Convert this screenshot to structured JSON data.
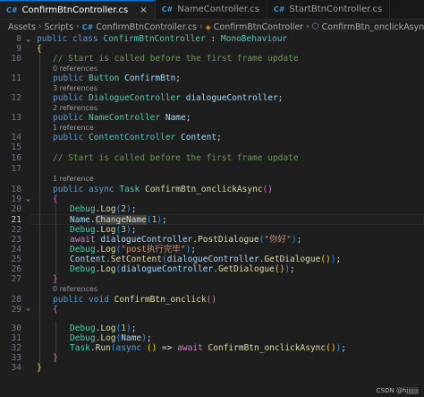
{
  "tabs": [
    {
      "icon": "C#",
      "label": "ConfirmBtnController.cs",
      "active": true,
      "close": "×"
    },
    {
      "icon": "C#",
      "label": "NameController.cs",
      "active": false
    },
    {
      "icon": "C#",
      "label": "StartBtnController.cs",
      "active": false
    }
  ],
  "breadcrumb": {
    "items": [
      "Assets",
      "Scripts"
    ],
    "file": "ConfirmBtnController.cs",
    "class": "ConfirmBtnController",
    "method": "ConfirmBtn_onclickAsync()"
  },
  "editor": {
    "current_line": 21,
    "line_numbers": [
      8,
      9,
      10,
      11,
      12,
      13,
      14,
      15,
      16,
      17,
      18,
      19,
      20,
      21,
      22,
      23,
      24,
      25,
      26,
      27,
      28,
      29,
      30,
      31,
      32,
      33,
      34
    ],
    "codelens": {
      "refs_0": "0 references",
      "refs_3": "3 references",
      "refs_2": "2 references",
      "refs_1a": "1 reference",
      "refs_1b": "1 reference",
      "refs_0b": "0 references"
    },
    "code": {
      "l8": {
        "kw": "public class ",
        "ty": "ConfirmBtnController",
        "sep": " : ",
        "base": "MonoBehaviour"
      },
      "l9": "{",
      "l10": "// Start is called before the first frame update",
      "l11": {
        "kw": "public ",
        "ty": "Button ",
        "va": "ConfirmBtn",
        "end": ";"
      },
      "l12": {
        "kw": "public ",
        "ty": "DialogueController ",
        "va": "dialogueController",
        "end": ";"
      },
      "l13": {
        "kw": "public ",
        "ty": "NameController ",
        "va": "Name",
        "end": ";"
      },
      "l14": {
        "kw": "public ",
        "ty": "ContentController ",
        "va": "Content",
        "end": ";"
      },
      "l16": "// Start is called before the first frame update",
      "l18": {
        "kw": "public async ",
        "ty": "Task ",
        "fn": "ConfirmBtn_onclickAsync",
        "paren": "()"
      },
      "l19": "{",
      "l20": {
        "ty": "Debug",
        "dot": ".",
        "fn": "Log",
        "o": "(",
        "nm": "2",
        "c": ")",
        "end": ";"
      },
      "l21": {
        "va": "Name",
        "dot": ".",
        "fn": "ChangeName",
        "o": "(",
        "nm": "1",
        "c": ")",
        "end": ";"
      },
      "l22": {
        "ty": "Debug",
        "dot": ".",
        "fn": "Log",
        "o": "(",
        "nm": "3",
        "c": ")",
        "end": ";"
      },
      "l23": {
        "ct": "await ",
        "va": "dialogueController",
        "dot": ".",
        "fn": "PostDialogue",
        "o": "(",
        "st": "\"你好\"",
        "c": ")",
        "end": ";"
      },
      "l24": {
        "ty": "Debug",
        "dot": ".",
        "fn": "Log",
        "o": "(",
        "st": "\"post执行完毕\"",
        "c": ")",
        "end": ";"
      },
      "l25": {
        "va": "Content",
        "dot": ".",
        "fn": "SetContent",
        "o": "(",
        "va2": "dialogueController",
        "dot2": ".",
        "fn2": "GetDialogue",
        "p2": "()",
        "c": ")",
        "end": ";"
      },
      "l26": {
        "ty": "Debug",
        "dot": ".",
        "fn": "Log",
        "o": "(",
        "va2": "dialogueController",
        "dot2": ".",
        "fn2": "GetDialogue",
        "p2": "()",
        "c": ")",
        "end": ";"
      },
      "l27": "}",
      "l28": {
        "kw": "public void ",
        "fn": "ConfirmBtn_onclick",
        "paren": "()"
      },
      "l29": "{",
      "l30": {
        "ty": "Debug",
        "dot": ".",
        "fn": "Log",
        "o": "(",
        "nm": "1",
        "c": ")",
        "end": ";"
      },
      "l31": {
        "ty": "Debug",
        "dot": ".",
        "fn": "Log",
        "o": "(",
        "va": "Name",
        "c": ")",
        "end": ";"
      },
      "l32": {
        "ty": "Task",
        "dot": ".",
        "fn": "Run",
        "o": "(",
        "kw": "async ",
        "p": "()",
        "arrow": " => ",
        "ct": "await ",
        "fn2": "ConfirmBtn_onclickAsync",
        "p2": "()",
        "c": ")",
        "end": ";"
      },
      "l33": "}",
      "l34": "}"
    }
  },
  "watermark": "CSDN @hjjjjjjj",
  "colors": {
    "accent": "#0078d4",
    "keyword": "#569cd6",
    "type": "#4ec9b0",
    "function": "#dcdcaa",
    "variable": "#9cdcfe",
    "number": "#b5cea8",
    "string": "#ce9178",
    "comment": "#6a9955",
    "control": "#c586c0"
  }
}
